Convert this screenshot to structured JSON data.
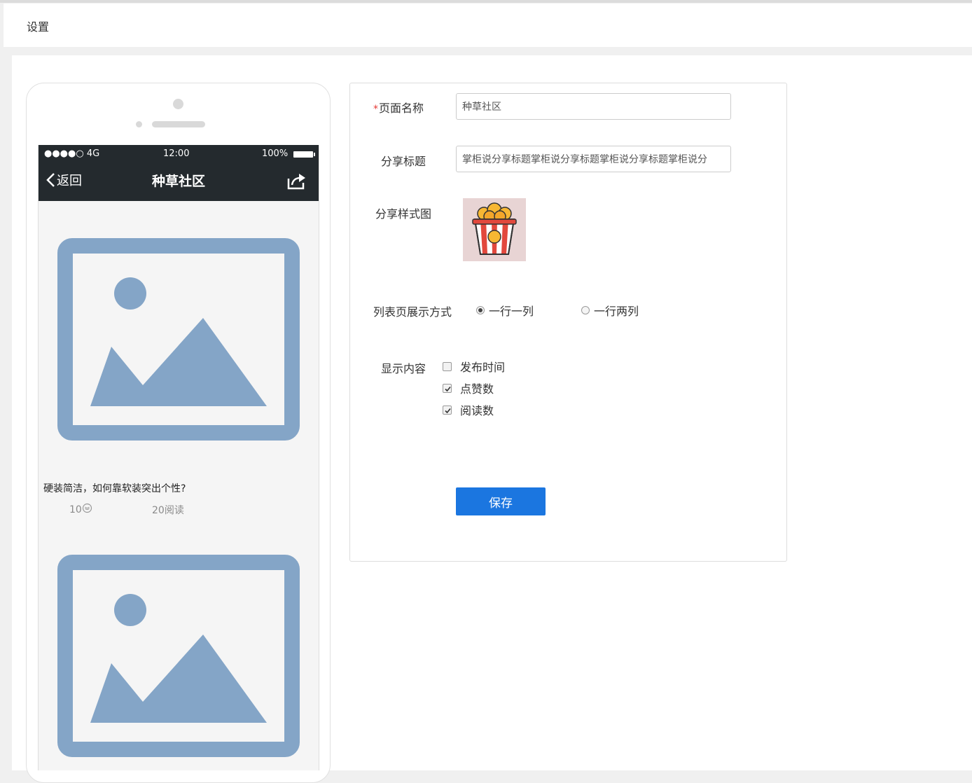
{
  "header": {
    "title": "设置"
  },
  "phone": {
    "status": {
      "signal": "●●●●○ 4G",
      "time": "12:00",
      "battery": "100%"
    },
    "nav": {
      "back_label": "返回",
      "title": "种草社区"
    },
    "article": {
      "title": "硬装简洁，如何靠软装突出个性?",
      "likes": "10",
      "reads": "20阅读"
    },
    "image_color": "#84a5c7"
  },
  "form": {
    "page_name": {
      "label": "页面名称",
      "required_mark": "*",
      "value": "种草社区"
    },
    "share_title": {
      "label": "分享标题",
      "value": "掌柜说分享标题掌柜说分享标题掌柜说分享标题掌柜说分"
    },
    "share_image": {
      "label": "分享样式图"
    },
    "list_mode": {
      "label": "列表页展示方式",
      "options": [
        {
          "label": "一行一列",
          "selected": true
        },
        {
          "label": "一行两列",
          "selected": false
        }
      ]
    },
    "display": {
      "label": "显示内容",
      "options": [
        {
          "label": "发布时间",
          "checked": false
        },
        {
          "label": "点赞数",
          "checked": true
        },
        {
          "label": "阅读数",
          "checked": true
        }
      ]
    },
    "save_label": "保存",
    "accent": "#1b76e0"
  }
}
